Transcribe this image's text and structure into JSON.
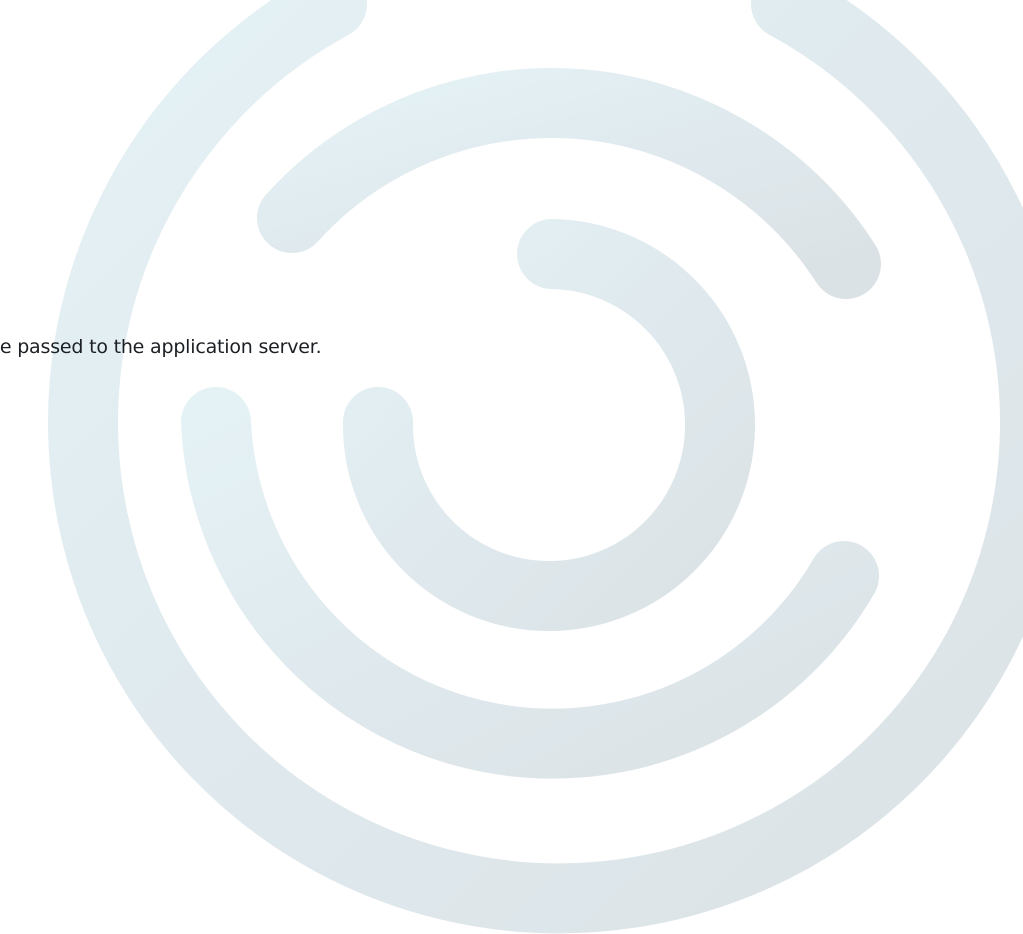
{
  "message": {
    "text": "be passed to the application server."
  },
  "watermark": {
    "icon": "concentric-arcs-logo-icon",
    "color_light": "#e4f1f5",
    "color_dark": "#dbe2e6"
  }
}
